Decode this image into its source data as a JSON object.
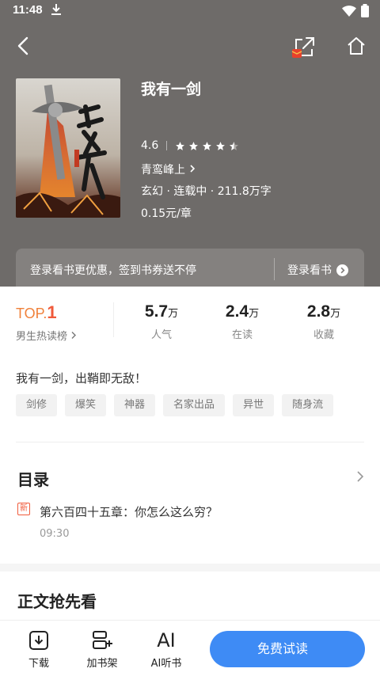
{
  "status": {
    "time": "11:48"
  },
  "book": {
    "title": "我有一剑",
    "rating": "4.6",
    "author": "青鸾峰上",
    "meta": "玄幻 · 连载中 · 211.8万字",
    "price": "0.15元/章",
    "cover_title": "我有一剑"
  },
  "promo": {
    "text": "登录看书更优惠，签到书券送不停",
    "button": "登录看书"
  },
  "stats": {
    "rank_prefix": "TOP.",
    "rank_num": "1",
    "rank_label": "男生热读榜",
    "items": [
      {
        "value": "5.7",
        "unit": "万",
        "label": "人气"
      },
      {
        "value": "2.4",
        "unit": "万",
        "label": "在读"
      },
      {
        "value": "2.8",
        "unit": "万",
        "label": "收藏"
      }
    ]
  },
  "slogan": "我有一剑，出鞘即无敌！",
  "tags": [
    "剑修",
    "爆笑",
    "神器",
    "名家出品",
    "异世",
    "随身流"
  ],
  "toc": {
    "title": "目录",
    "new_badge": "新",
    "latest_chapter": "第六百四十五章：你怎么这么穷？",
    "time": "09:30"
  },
  "preview_title": "正文抢先看",
  "bottom": {
    "download": "下载",
    "add_shelf": "加书架",
    "ai_listen": "AI听书",
    "ai_glyph": "AI",
    "read_button": "免费试读"
  },
  "colors": {
    "header_bg": "#6e6b69",
    "accent": "#3e8bf5",
    "rank": "#f0813a"
  }
}
